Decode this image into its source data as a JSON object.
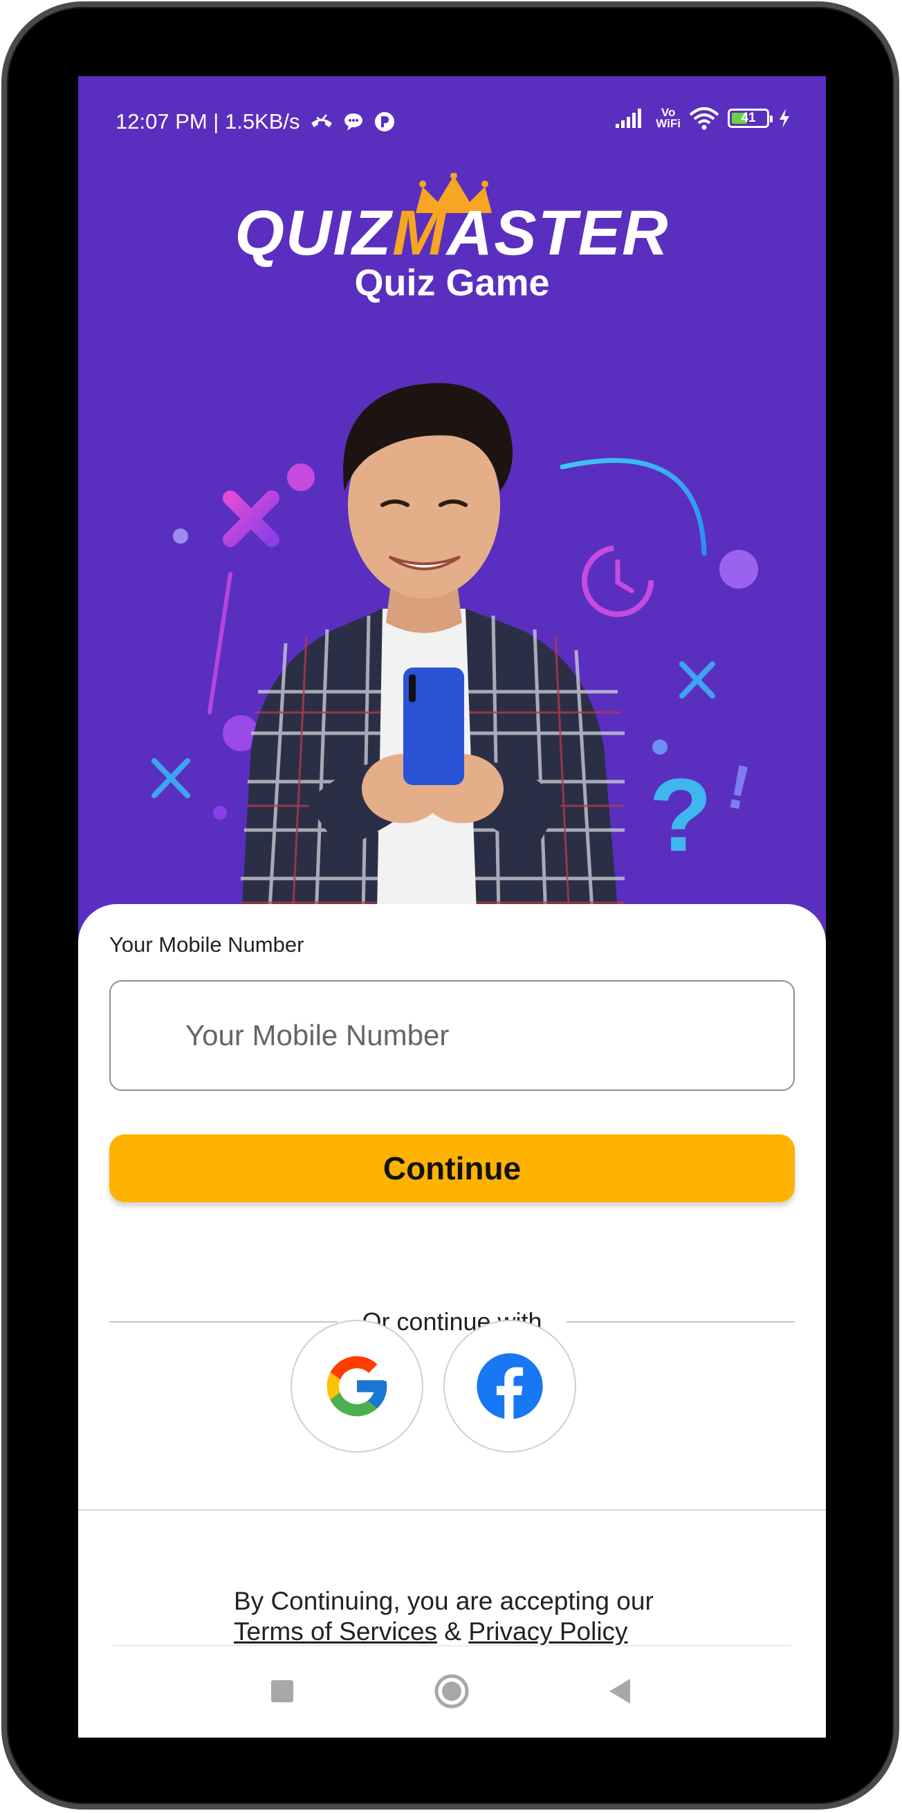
{
  "status_bar": {
    "time_speed": "12:07 PM | 1.5KB/s",
    "vowifi_line1": "Vo",
    "vowifi_line2": "WiFi",
    "battery_level": "41",
    "icons": [
      "missed-call-icon",
      "chat-icon",
      "app-notification-icon",
      "signal-icon",
      "wifi-icon",
      "battery-icon",
      "charging-icon"
    ]
  },
  "hero": {
    "logo_text_1": "QUIZ",
    "logo_text_m": "M",
    "logo_text_2": "ASTER",
    "subtitle": "Quiz Game"
  },
  "login": {
    "field_label": "Your Mobile Number",
    "phone_placeholder": "Your Mobile Number",
    "phone_value": "",
    "continue_label": "Continue",
    "divider_text": "Or continue with",
    "social": [
      {
        "name": "Google",
        "icon": "google-icon"
      },
      {
        "name": "Facebook",
        "icon": "facebook-icon"
      }
    ]
  },
  "terms": {
    "prefix": "By Continuing, you are accepting our",
    "terms_link": "Terms of Services",
    "joiner": " & ",
    "privacy_link": "Privacy Policy"
  },
  "navigation": {
    "buttons": [
      "recent-apps-icon",
      "home-icon",
      "back-icon"
    ]
  },
  "colors": {
    "brand_purple": "#5a2fbf",
    "accent_yellow": "#fdb300",
    "logo_orange": "#f6a623",
    "facebook_blue": "#1877f2"
  }
}
